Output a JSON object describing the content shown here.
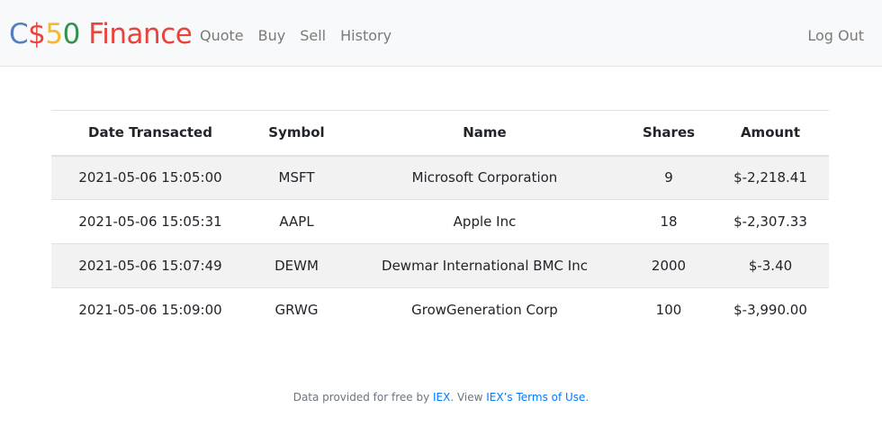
{
  "brand": {
    "parts": [
      {
        "text": "C",
        "color": "#537fbe"
      },
      {
        "text": "$",
        "color": "#ea433b"
      },
      {
        "text": "5",
        "color": "#f5b82e"
      },
      {
        "text": "0",
        "color": "#2e944b"
      },
      {
        "text": " Finance",
        "color": "#ea433b"
      }
    ]
  },
  "nav": {
    "quote": "Quote",
    "buy": "Buy",
    "sell": "Sell",
    "history": "History",
    "logout": "Log Out"
  },
  "table": {
    "headers": [
      "Date Transacted",
      "Symbol",
      "Name",
      "Shares",
      "Amount"
    ],
    "rows": [
      [
        "2021-05-06 15:05:00",
        "MSFT",
        "Microsoft Corporation",
        "9",
        "$-2,218.41"
      ],
      [
        "2021-05-06 15:05:31",
        "AAPL",
        "Apple Inc",
        "18",
        "$-2,307.33"
      ],
      [
        "2021-05-06 15:07:49",
        "DEWM",
        "Dewmar International BMC Inc",
        "2000",
        "$-3.40"
      ],
      [
        "2021-05-06 15:09:00",
        "GRWG",
        "GrowGeneration Corp",
        "100",
        "$-3,990.00"
      ]
    ]
  },
  "footer": {
    "prefix": "Data provided for free by ",
    "iex_link": "IEX",
    "middle": ". View ",
    "terms_link": "IEX’s Terms of Use",
    "suffix": "."
  }
}
